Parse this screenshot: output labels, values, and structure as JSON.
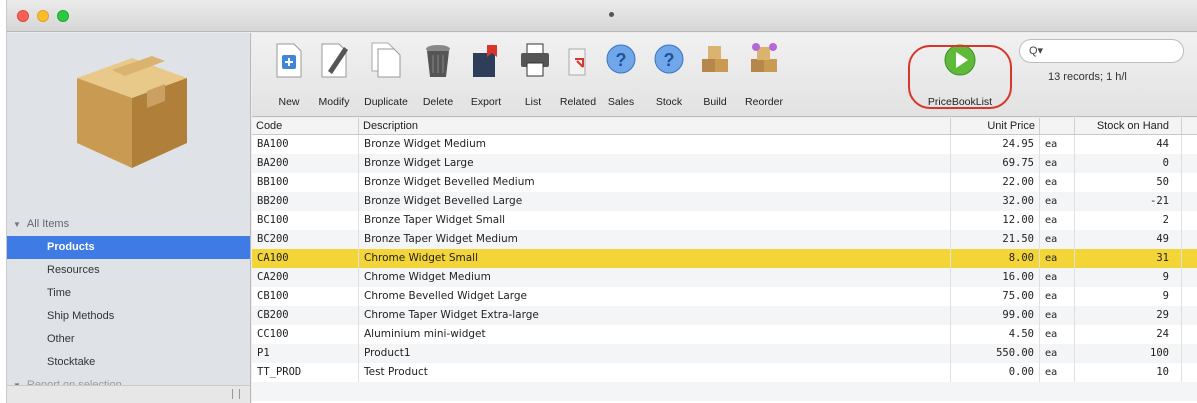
{
  "toolbar": {
    "buttons": [
      {
        "id": "new",
        "label": "New",
        "icon": "new-document-icon"
      },
      {
        "id": "modify",
        "label": "Modify",
        "icon": "pencil-document-icon"
      },
      {
        "id": "duplicate",
        "label": "Duplicate",
        "icon": "duplicate-document-icon"
      },
      {
        "id": "delete",
        "label": "Delete",
        "icon": "trash-icon"
      },
      {
        "id": "export",
        "label": "Export",
        "icon": "export-icon"
      },
      {
        "id": "list",
        "label": "List",
        "icon": "printer-icon"
      },
      {
        "id": "related",
        "label": "Related",
        "icon": "related-icon"
      },
      {
        "id": "sales",
        "label": "Sales",
        "icon": "help-bubble-icon"
      },
      {
        "id": "stock",
        "label": "Stock",
        "icon": "help-bubble-icon"
      },
      {
        "id": "build",
        "label": "Build",
        "icon": "boxes-icon"
      },
      {
        "id": "reorder",
        "label": "Reorder",
        "icon": "reorder-boxes-icon"
      },
      {
        "id": "pricebooklist",
        "label": "PriceBookList",
        "icon": "play-icon"
      }
    ],
    "search_placeholder": "",
    "records_text": "13 records; 1 h/l"
  },
  "sidebar": {
    "items": [
      {
        "label": "All Items",
        "type": "group"
      },
      {
        "label": "Products",
        "type": "item",
        "selected": true
      },
      {
        "label": "Resources",
        "type": "item"
      },
      {
        "label": "Time",
        "type": "item"
      },
      {
        "label": "Ship Methods",
        "type": "item"
      },
      {
        "label": "Other",
        "type": "item"
      },
      {
        "label": "Stocktake",
        "type": "item"
      },
      {
        "label": "Report on selection",
        "type": "group"
      }
    ]
  },
  "table": {
    "headers": {
      "code": "Code",
      "description": "Description",
      "price": "Unit Price",
      "unit": "",
      "stock": "Stock on Hand"
    },
    "rows": [
      {
        "code": "BA100",
        "description": "Bronze Widget Medium",
        "price": "24.95",
        "unit": "ea",
        "stock": "44"
      },
      {
        "code": "BA200",
        "description": "Bronze Widget Large",
        "price": "69.75",
        "unit": "ea",
        "stock": "0"
      },
      {
        "code": "BB100",
        "description": "Bronze Widget Bevelled Medium",
        "price": "22.00",
        "unit": "ea",
        "stock": "50"
      },
      {
        "code": "BB200",
        "description": "Bronze Widget Bevelled Large",
        "price": "32.00",
        "unit": "ea",
        "stock": "-21"
      },
      {
        "code": "BC100",
        "description": "Bronze Taper Widget Small",
        "price": "12.00",
        "unit": "ea",
        "stock": "2"
      },
      {
        "code": "BC200",
        "description": "Bronze Taper Widget Medium",
        "price": "21.50",
        "unit": "ea",
        "stock": "49"
      },
      {
        "code": "CA100",
        "description": "Chrome Widget Small",
        "price": "8.00",
        "unit": "ea",
        "stock": "31",
        "selected": true
      },
      {
        "code": "CA200",
        "description": "Chrome Widget Medium",
        "price": "16.00",
        "unit": "ea",
        "stock": "9"
      },
      {
        "code": "CB100",
        "description": "Chrome Bevelled Widget Large",
        "price": "75.00",
        "unit": "ea",
        "stock": "9"
      },
      {
        "code": "CB200",
        "description": "Chrome Taper Widget Extra-large",
        "price": "99.00",
        "unit": "ea",
        "stock": "29"
      },
      {
        "code": "CC100",
        "description": "Aluminium mini-widget",
        "price": "4.50",
        "unit": "ea",
        "stock": "24"
      },
      {
        "code": "P1",
        "description": "Product1",
        "price": "550.00",
        "unit": "ea",
        "stock": "100"
      },
      {
        "code": "TT_PROD",
        "description": "Test Product",
        "price": "0.00",
        "unit": "ea",
        "stock": "10"
      }
    ]
  },
  "colors": {
    "selection_row": "#f3d538",
    "sidebar_selected": "#3e7be4",
    "highlight_ring": "#d9352a"
  }
}
